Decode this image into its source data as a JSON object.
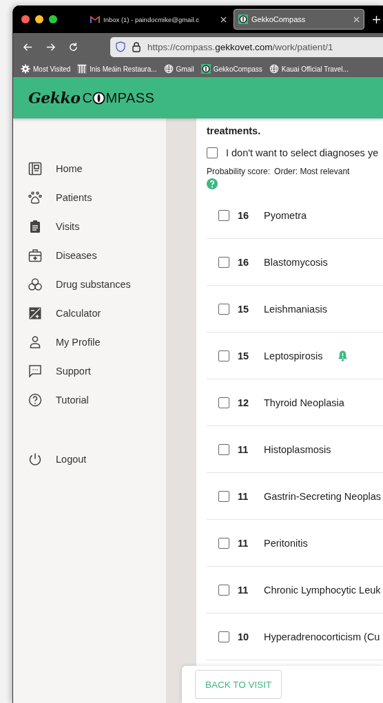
{
  "browser": {
    "tabs": [
      {
        "title": "Inbox (1) - paindocmike@gmail.c",
        "kind": "gmail",
        "selected": false
      },
      {
        "title": "GekkoCompass",
        "kind": "gekko",
        "selected": true
      }
    ],
    "url": {
      "prefix": "https://compass.",
      "domain": "gekkovet.com",
      "path": "/work/patient/1"
    },
    "bookmarks": [
      {
        "label": "Most Visited",
        "kind": "gear"
      },
      {
        "label": "Inis Meáin Restaura...",
        "kind": "bars"
      },
      {
        "label": "Gmail",
        "kind": "globe"
      },
      {
        "label": "GekkoCompass",
        "kind": "gekko"
      },
      {
        "label": "Kauai Official Travel...",
        "kind": "globe"
      }
    ]
  },
  "logo": {
    "script": "Gekko",
    "before": "C",
    "after": "MPASS"
  },
  "sidebar": {
    "items": [
      {
        "label": "Home",
        "kind": "home"
      },
      {
        "label": "Patients",
        "kind": "paw"
      },
      {
        "label": "Visits",
        "kind": "clipboard"
      },
      {
        "label": "Diseases",
        "kind": "kit"
      },
      {
        "label": "Drug substances",
        "kind": "pills"
      },
      {
        "label": "Calculator",
        "kind": "calc"
      },
      {
        "label": "My Profile",
        "kind": "person"
      },
      {
        "label": "Support",
        "kind": "chat"
      },
      {
        "label": "Tutorial",
        "kind": "help"
      }
    ],
    "logout": {
      "label": "Logout"
    }
  },
  "content": {
    "heading": "treatments.",
    "skip": {
      "label": "I don't want to select diagnoses ye",
      "checked": false
    },
    "probability_label": "Probability score:",
    "order_label": "Order: Most relevant",
    "rows": [
      {
        "score": "16",
        "name": "Pyometra",
        "checked": false,
        "alert": false
      },
      {
        "score": "16",
        "name": "Blastomycosis",
        "checked": false,
        "alert": false
      },
      {
        "score": "15",
        "name": "Leishmaniasis",
        "checked": false,
        "alert": false
      },
      {
        "score": "15",
        "name": "Leptospirosis",
        "checked": false,
        "alert": true
      },
      {
        "score": "12",
        "name": "Thyroid Neoplasia",
        "checked": false,
        "alert": false
      },
      {
        "score": "11",
        "name": "Histoplasmosis",
        "checked": false,
        "alert": false
      },
      {
        "score": "11",
        "name": "Gastrin-Secreting Neoplas",
        "checked": false,
        "alert": false
      },
      {
        "score": "11",
        "name": "Peritonitis",
        "checked": false,
        "alert": false
      },
      {
        "score": "11",
        "name": "Chronic Lymphocytic Leuk",
        "checked": false,
        "alert": false
      },
      {
        "score": "10",
        "name": "Hyperadrenocorticism (Cu",
        "checked": false,
        "alert": false
      }
    ],
    "back_button": "BACK TO VISIT"
  }
}
